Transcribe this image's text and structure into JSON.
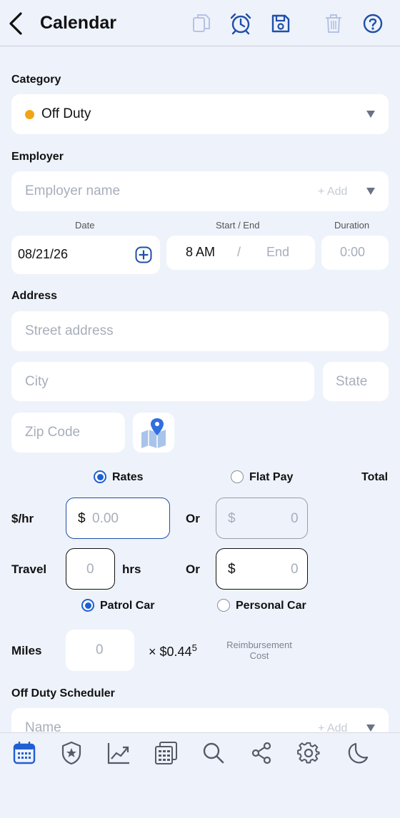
{
  "header": {
    "title": "Calendar"
  },
  "category": {
    "label": "Category",
    "value": "Off Duty",
    "dot_color": "#f2a514"
  },
  "employer": {
    "label": "Employer",
    "placeholder": "Employer name",
    "add_label": "+ Add"
  },
  "datetime": {
    "date_label": "Date",
    "date_value": "08/21/26",
    "start_end_label": "Start / End",
    "start_value": "8 AM",
    "separator": "/",
    "end_placeholder": "End",
    "duration_label": "Duration",
    "duration_placeholder": "0:00"
  },
  "address": {
    "label": "Address",
    "street_placeholder": "Street address",
    "city_placeholder": "City",
    "state_placeholder": "State",
    "zip_placeholder": "Zip Code"
  },
  "pay": {
    "rates_label": "Rates",
    "flat_label": "Flat Pay",
    "total_label": "Total",
    "hourly_label": "$/hr",
    "hourly_currency": "$",
    "hourly_placeholder": "0.00",
    "or_label": "Or",
    "flat_currency": "$",
    "flat_placeholder": "0",
    "travel_label": "Travel",
    "travel_placeholder": "0",
    "hrs_label": "hrs",
    "travel_flat_currency": "$",
    "travel_flat_placeholder": "0",
    "patrol_car_label": "Patrol Car",
    "personal_car_label": "Personal Car",
    "miles_label": "Miles",
    "miles_placeholder": "0",
    "rate_multiplier": "× $0.44",
    "rate_superscript": "5",
    "reimbursement_label_1": "Reimbursement",
    "reimbursement_label_2": "Cost"
  },
  "scheduler": {
    "label": "Off Duty Scheduler",
    "placeholder": "Name",
    "add_label": "+ Add"
  },
  "colors": {
    "accent": "#1f5fd1",
    "background": "#eef2fb",
    "placeholder": "#a7aebb"
  }
}
